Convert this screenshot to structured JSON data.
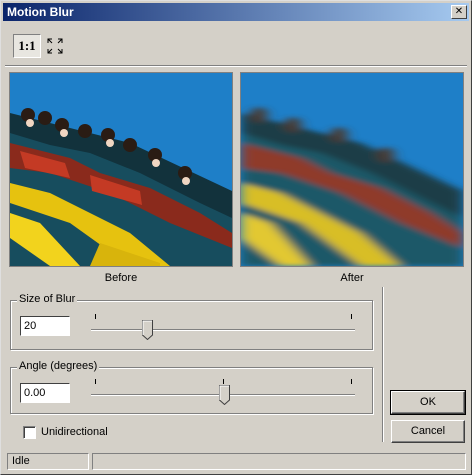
{
  "window": {
    "title": "Motion Blur",
    "close_glyph": "✕"
  },
  "toolbar": {
    "actual_size_label": "1:1",
    "fit_icon": "fit-to-window-icon"
  },
  "preview": {
    "before_caption": "Before",
    "after_caption": "After"
  },
  "size_of_blur": {
    "label": "Size of Blur",
    "value": "20",
    "slider_fraction": 0.2
  },
  "angle": {
    "label": "Angle (degrees)",
    "value": "0.00",
    "slider_fraction": 0.5
  },
  "unidirectional": {
    "label": "Unidirectional",
    "checked": false
  },
  "buttons": {
    "ok": "OK",
    "cancel": "Cancel"
  },
  "status": {
    "text": "Idle",
    "secondary": ""
  },
  "colors": {
    "title_start": "#0a246a",
    "title_end": "#a6caf0",
    "face": "#d4d0c8",
    "sky": "#1e7fc8"
  }
}
